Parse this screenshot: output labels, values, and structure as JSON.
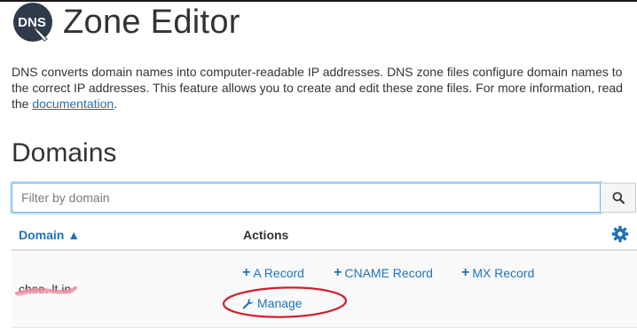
{
  "header": {
    "logo_text": "DNS",
    "title": "Zone Editor"
  },
  "description": {
    "text": "DNS converts domain names into computer-readable IP addresses. DNS zone files configure domain names to the correct IP addresses. This feature allows you to create and edit these zone files. For more information, read the ",
    "link_text": "documentation",
    "suffix": "."
  },
  "section": {
    "title": "Domains"
  },
  "filter": {
    "placeholder": "Filter by domain",
    "value": ""
  },
  "table": {
    "columns": {
      "domain": "Domain ▲",
      "actions": "Actions"
    },
    "rows": [
      {
        "domain": "chse.      lt.in",
        "actions": {
          "a_record": "A Record",
          "cname_record": "CNAME Record",
          "mx_record": "MX Record",
          "manage": "Manage"
        }
      }
    ]
  },
  "icons": {
    "search": "search-icon",
    "settings": "gear-icon",
    "add": "plus-icon",
    "manage": "wrench-icon"
  },
  "colors": {
    "link": "#1e74b8",
    "annotation": "#d0202c",
    "redaction": "#f08aa0"
  }
}
